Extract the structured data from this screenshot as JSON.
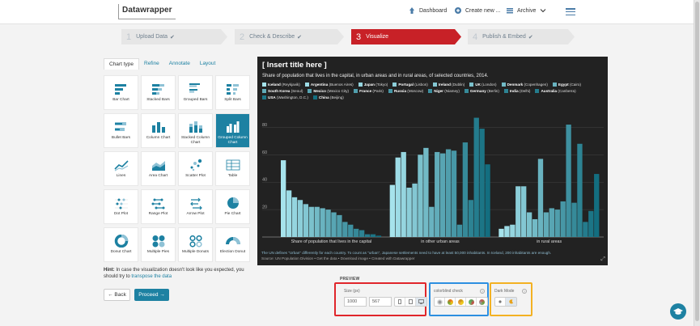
{
  "app": {
    "logo": "Datawrapper",
    "nav": {
      "dashboard": "Dashboard",
      "create_new": "Create new ...",
      "archive": "Archive"
    }
  },
  "steps": [
    {
      "num": "1",
      "label": "Upload Data",
      "check": "✔"
    },
    {
      "num": "2",
      "label": "Check & Describe",
      "check": "✔"
    },
    {
      "num": "3",
      "label": "Visualize",
      "check": ""
    },
    {
      "num": "4",
      "label": "Publish & Embed",
      "check": "✔"
    }
  ],
  "tabs": [
    "Chart type",
    "Refine",
    "Annotate",
    "Layout"
  ],
  "chart_types": [
    {
      "label": "Bar Chart",
      "icon": "bar-chart-icon"
    },
    {
      "label": "Stacked Bars",
      "icon": "stacked-bars-icon"
    },
    {
      "label": "Grouped Bars",
      "icon": "grouped-bars-icon"
    },
    {
      "label": "Split Bars",
      "icon": "split-bars-icon"
    },
    {
      "label": "Bullet Bars",
      "icon": "bullet-bars-icon"
    },
    {
      "label": "Column Chart",
      "icon": "column-chart-icon"
    },
    {
      "label": "Stacked Column Chart",
      "icon": "stacked-column-icon"
    },
    {
      "label": "Grouped Column Chart",
      "icon": "grouped-column-icon",
      "selected": true
    },
    {
      "label": "Lines",
      "icon": "lines-icon"
    },
    {
      "label": "Area Chart",
      "icon": "area-chart-icon"
    },
    {
      "label": "Scatter Plot",
      "icon": "scatter-plot-icon"
    },
    {
      "label": "Table",
      "icon": "table-icon"
    },
    {
      "label": "Dot Plot",
      "icon": "dot-plot-icon"
    },
    {
      "label": "Range Plot",
      "icon": "range-plot-icon"
    },
    {
      "label": "Arrow Plot",
      "icon": "arrow-plot-icon"
    },
    {
      "label": "Pie Chart",
      "icon": "pie-chart-icon"
    },
    {
      "label": "Donut Chart",
      "icon": "donut-chart-icon"
    },
    {
      "label": "Multiple Pies",
      "icon": "multiple-pies-icon"
    },
    {
      "label": "Multiple Donuts",
      "icon": "multiple-donuts-icon"
    },
    {
      "label": "Election Donut",
      "icon": "election-donut-icon"
    }
  ],
  "hint": {
    "bold": "Hint:",
    "text": "In case the visualization doesn't look like you expected, you should try to",
    "link": "transpose the data"
  },
  "buttons": {
    "back": "← Back",
    "proceed": "Proceed →"
  },
  "preview": {
    "label": "PREVIEW",
    "size_label": "Size (px)",
    "width": "1000",
    "height": "567",
    "colorblind_label": "colorblind check",
    "dark_mode_label": "Dark Mode"
  },
  "colors": {
    "accent": "#1d81a2",
    "active_step": "#c82127",
    "chart_bg": "#222222"
  },
  "chart_data": {
    "type": "bar",
    "title": "[ Insert title here ]",
    "description": "Share of population that lives in the capital, in urban areas and in rural areas, of selected countries, 2014.",
    "categories": [
      "Share of population that lives in the capital",
      "in other urban areas",
      "in rural areas"
    ],
    "ylim": [
      0,
      95
    ],
    "yticks": [
      0,
      20,
      40,
      60,
      80
    ],
    "grid": true,
    "legend_position": "top",
    "series": [
      {
        "name": "Iceland",
        "sub": "(Reykjavik)",
        "values": [
          56,
          38,
          6
        ]
      },
      {
        "name": "Argentina",
        "sub": "(Buenos Aires)",
        "values": [
          34,
          58,
          8
        ]
      },
      {
        "name": "Japan",
        "sub": "(Tokyo)",
        "values": [
          29,
          62,
          9
        ]
      },
      {
        "name": "Portugal",
        "sub": "(Lisbon)",
        "values": [
          27,
          36,
          37
        ]
      },
      {
        "name": "Ireland",
        "sub": "(Dublin)",
        "values": [
          24,
          39,
          37
        ]
      },
      {
        "name": "UK",
        "sub": "(London)",
        "values": [
          22,
          60,
          18
        ]
      },
      {
        "name": "Denmark",
        "sub": "(Copenhagen)",
        "values": [
          22,
          65,
          13
        ]
      },
      {
        "name": "Egypt",
        "sub": "(Cairo)",
        "values": [
          21,
          22,
          57
        ]
      },
      {
        "name": "South Korea",
        "sub": "(Seoul)",
        "values": [
          20,
          62,
          18
        ]
      },
      {
        "name": "Mexico",
        "sub": "(Mexico City)",
        "values": [
          18,
          61,
          21
        ]
      },
      {
        "name": "France",
        "sub": "(Paris)",
        "values": [
          16,
          64,
          20
        ]
      },
      {
        "name": "Russia",
        "sub": "(Moscow)",
        "values": [
          11,
          63,
          26
        ]
      },
      {
        "name": "Niger",
        "sub": "(Niamey)",
        "values": [
          9,
          9,
          82
        ]
      },
      {
        "name": "Germany",
        "sub": "(Berlin)",
        "values": [
          6,
          69,
          25
        ]
      },
      {
        "name": "India",
        "sub": "(Delhi)",
        "values": [
          5,
          27,
          68
        ]
      },
      {
        "name": "Australia",
        "sub": "(Canberra)",
        "values": [
          2,
          87,
          11
        ]
      },
      {
        "name": "USA",
        "sub": "(Washington, D.C.)",
        "values": [
          2,
          79,
          19
        ]
      },
      {
        "name": "China",
        "sub": "(Beijing)",
        "values": [
          1,
          53,
          46
        ]
      }
    ],
    "notes": "The UN defines \"Urban\" differently for each country. To count as \"urban\", Japanese settlements need to have at least 50,000 inhabitants. In Iceland, 200 inhabitants are enough.",
    "source": "Source: UN Population Division • Get the data • Download image • Created with Datawrapper"
  }
}
